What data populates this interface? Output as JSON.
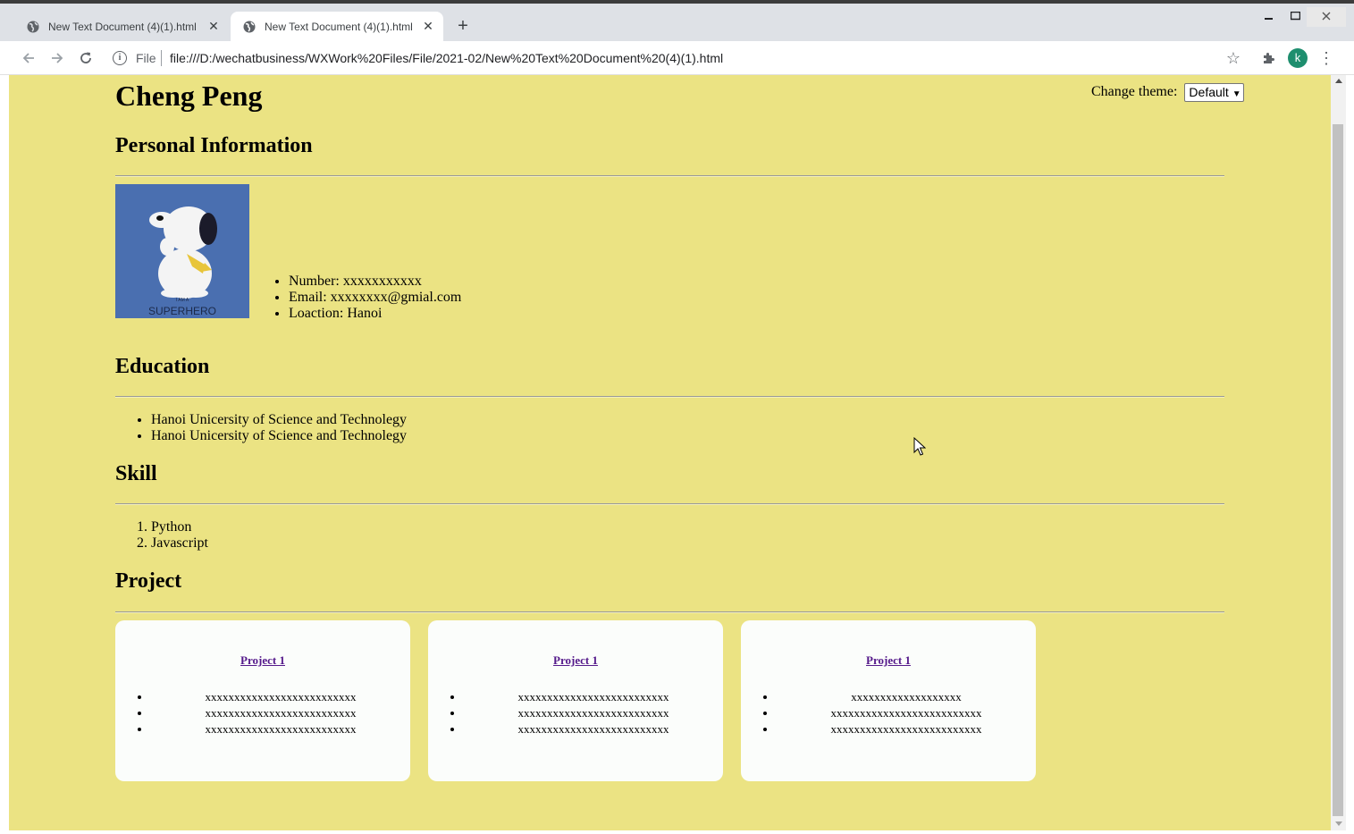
{
  "browser": {
    "tabs": [
      {
        "title": "New Text Document (4)(1).html",
        "active": false
      },
      {
        "title": "New Text Document (4)(1).html",
        "active": true
      }
    ],
    "new_tab_label": "+",
    "scheme_label": "File",
    "url": "file:///D:/wechatbusiness/WXWork%20Files/File/2021-02/New%20Text%20Document%20(4)(1).html",
    "profile_initial": "k",
    "close_label": "✕",
    "icons": [
      "back-arrow-icon",
      "forward-arrow-icon",
      "reload-icon",
      "info-icon",
      "star-icon",
      "extensions-icon",
      "menu-icon"
    ]
  },
  "page": {
    "background": "#ebe383",
    "name": "Cheng Peng",
    "theme": {
      "label": "Change theme:",
      "selected": "Default"
    },
    "personal": {
      "heading": "Personal Information",
      "photo_caption": [
        "I AM A",
        "SUPERHERO"
      ],
      "items": [
        "Number: xxxxxxxxxxx",
        "Email: xxxxxxxx@gmial.com",
        "Loaction: Hanoi"
      ]
    },
    "education": {
      "heading": "Education",
      "items": [
        "Hanoi Unicersity of Science and Technolegy",
        "Hanoi Unicersity of Science and Technolegy"
      ]
    },
    "skill": {
      "heading": "Skill",
      "items": [
        "Python",
        "Javascript"
      ]
    },
    "project": {
      "heading": "Project",
      "cards": [
        {
          "title": "Project 1",
          "items": [
            "xxxxxxxxxxxxxxxxxxxxxxxxxx",
            "xxxxxxxxxxxxxxxxxxxxxxxxxx",
            "xxxxxxxxxxxxxxxxxxxxxxxxxx"
          ]
        },
        {
          "title": "Project 1",
          "items": [
            "xxxxxxxxxxxxxxxxxxxxxxxxxx",
            "xxxxxxxxxxxxxxxxxxxxxxxxxx",
            "xxxxxxxxxxxxxxxxxxxxxxxxxx"
          ]
        },
        {
          "title": "Project 1",
          "items": [
            "xxxxxxxxxxxxxxxxxxx",
            "xxxxxxxxxxxxxxxxxxxxxxxxxx",
            "xxxxxxxxxxxxxxxxxxxxxxxxxx"
          ]
        }
      ]
    }
  }
}
